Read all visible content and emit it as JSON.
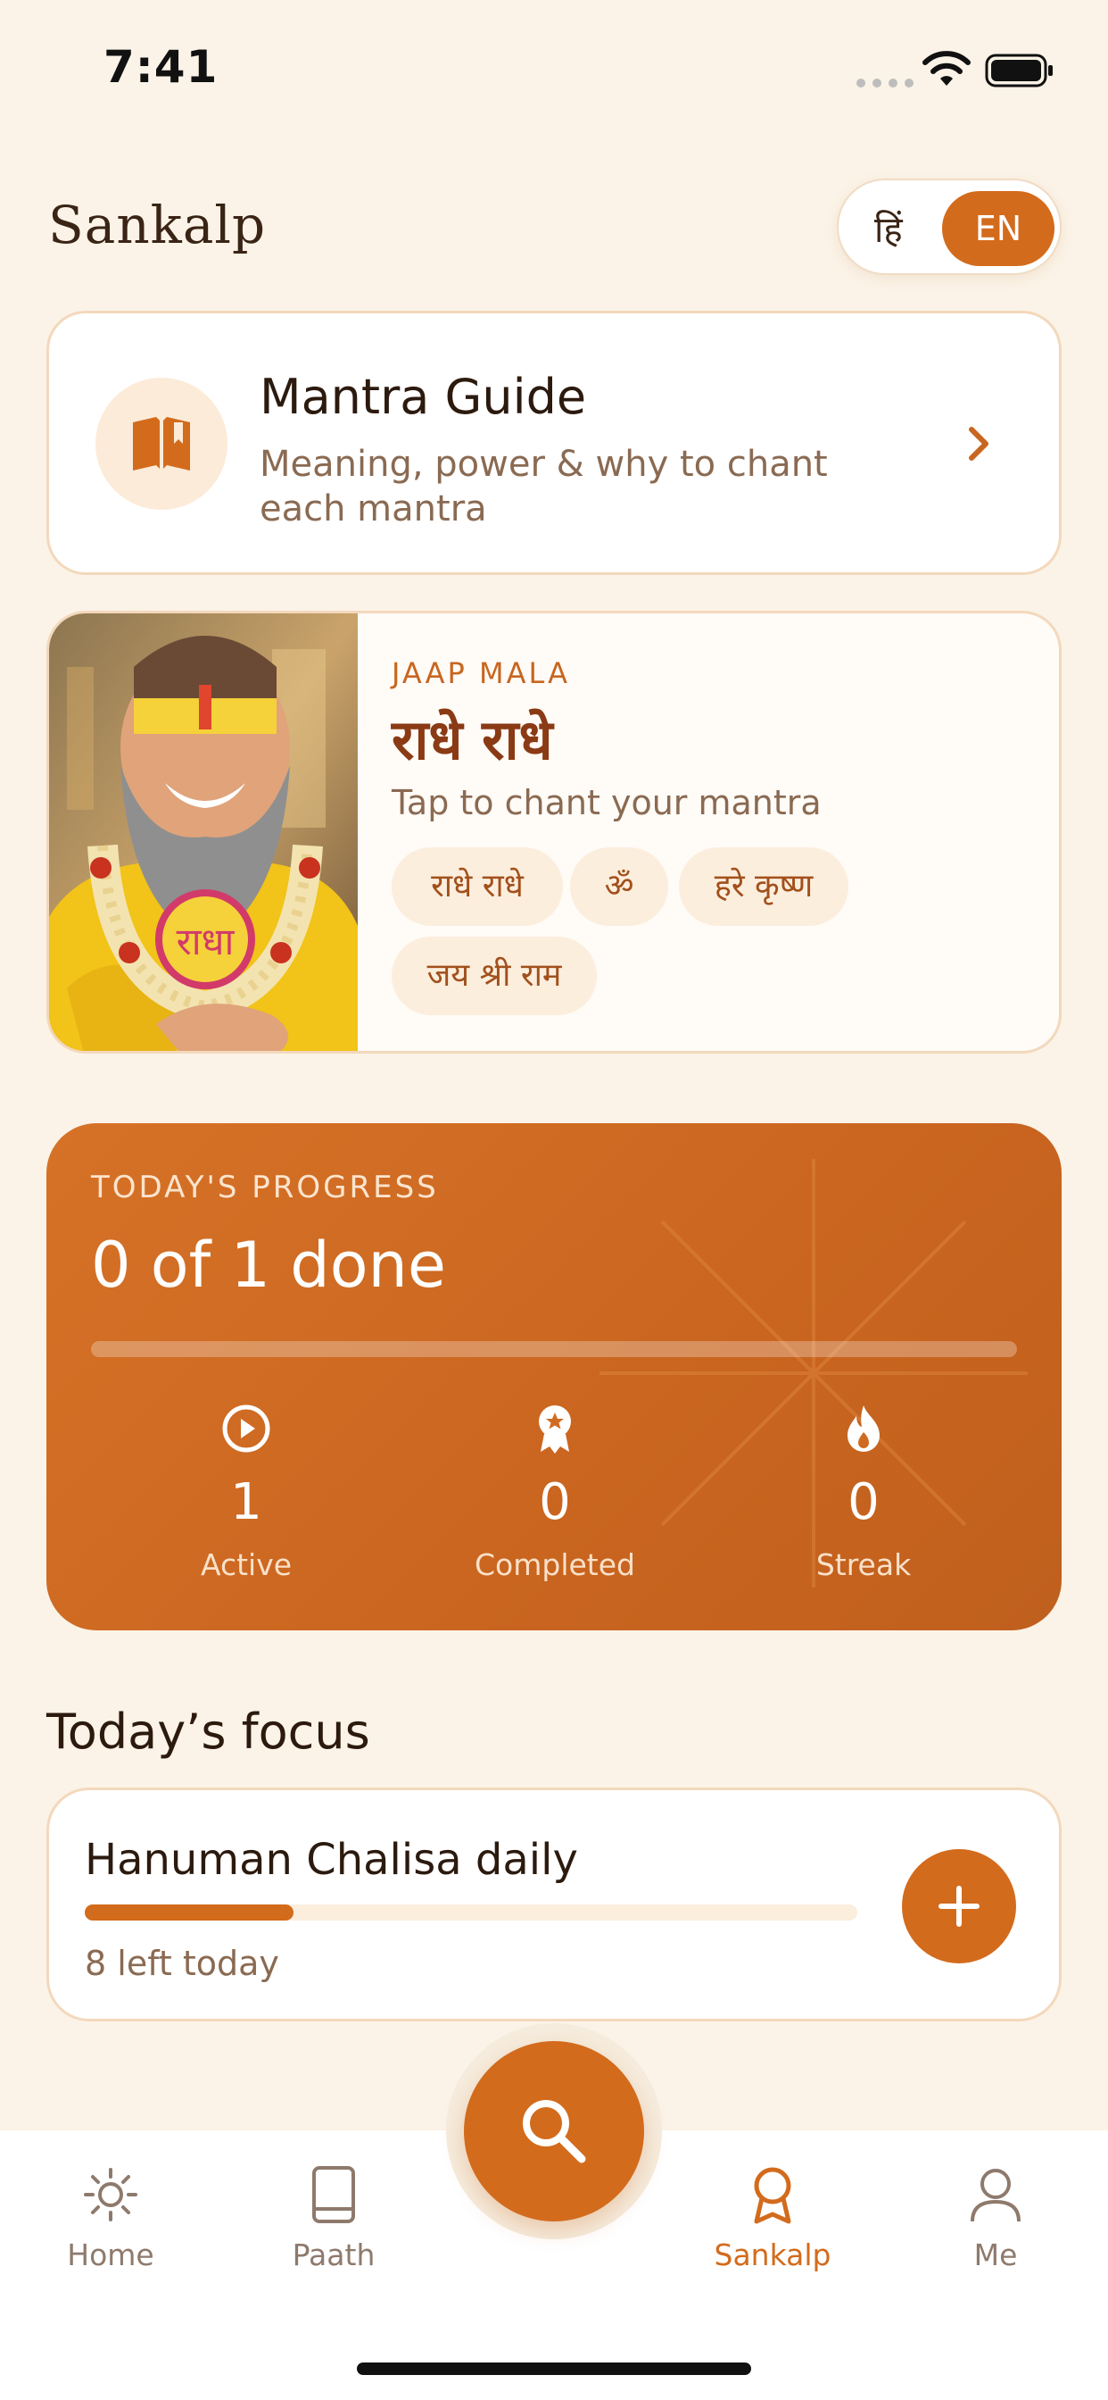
{
  "status": {
    "time": "7:41"
  },
  "header": {
    "title": "Sankalp",
    "lang_hi": "हिं",
    "lang_en": "EN"
  },
  "guide": {
    "title": "Mantra Guide",
    "subtitle": "Meaning, power & why to chant each mantra"
  },
  "mala": {
    "label": "JAAP MALA",
    "title": "राधे राधे",
    "subtitle": "Tap to chant your mantra",
    "chips": [
      "राधे राधे",
      "ॐ",
      "हरे कृष्ण",
      "जय श्री राम"
    ],
    "image_text": "राधा"
  },
  "progress": {
    "label": "TODAY'S PROGRESS",
    "title": "0 of 1 done",
    "fraction": 0,
    "stats": [
      {
        "value": "1",
        "label": "Active",
        "icon": "play-circle-icon"
      },
      {
        "value": "0",
        "label": "Completed",
        "icon": "award-icon"
      },
      {
        "value": "0",
        "label": "Streak",
        "icon": "flame-icon"
      }
    ]
  },
  "focus": {
    "heading": "Today’s focus",
    "title": "Hanuman Chalisa daily",
    "remaining": "8 left today",
    "fraction": 0.27
  },
  "tabs": [
    {
      "label": "Home",
      "icon": "sun-icon"
    },
    {
      "label": "Paath",
      "icon": "book-icon"
    },
    {
      "label": "Sankalp",
      "icon": "award-icon",
      "active": true
    },
    {
      "label": "Me",
      "icon": "user-icon"
    }
  ],
  "colors": {
    "accent": "#D36B1C",
    "background": "#FBF3E7",
    "card_border": "#F3D8BC"
  }
}
